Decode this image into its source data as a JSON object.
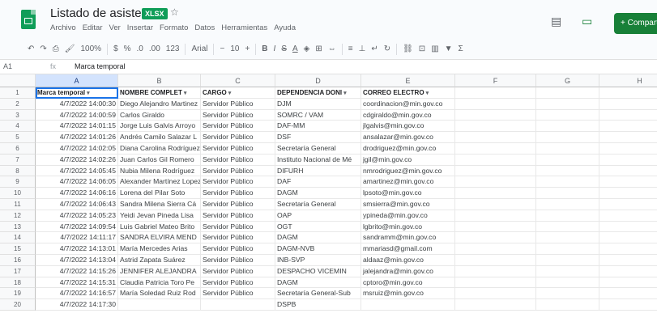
{
  "header": {
    "title": "Listado de asistencia",
    "badge": "XLSX",
    "menu": [
      "Archivo",
      "Editar",
      "Ver",
      "Insertar",
      "Formato",
      "Datos",
      "Herramientas",
      "Ayuda"
    ],
    "share_label": "+ Compartir"
  },
  "toolbar": {
    "zoom": "100%",
    "font": "Arial",
    "font_size": "10"
  },
  "formula_bar": {
    "cell_ref": "A1",
    "fx": "fx",
    "value": "Marca temporal"
  },
  "columns": [
    "A",
    "B",
    "C",
    "D",
    "E",
    "F",
    "G",
    "H"
  ],
  "table": {
    "headers": [
      "Marca temporal",
      "NOMBRE COMPLET",
      "CARGO",
      "DEPENDENCIA DONI",
      "CORREO ELECTRO"
    ],
    "rows": [
      [
        "4/7/2022 14:00:30",
        "Diego Alejandro Martinez",
        "Servidor Público",
        "DJM",
        "coordinacion@min.gov.co"
      ],
      [
        "4/7/2022 14:00:59",
        "Carlos Giraldo",
        "Servidor Público",
        "SOMRC / VAM",
        "cdgiraldo@min.gov.co"
      ],
      [
        "4/7/2022 14:01:15",
        "Jorge Luis Galvis Arroyo",
        "Servidor Público",
        "DAF-MM",
        "jlgalvis@min.gov.co"
      ],
      [
        "4/7/2022 14:01:26",
        "Andrés Camilo Salazar L",
        "Servidor Público",
        "DSF",
        "ansalazar@min.gov.co"
      ],
      [
        "4/7/2022 14:02:05",
        "Diana Carolina Rodríguez",
        "Servidor Público",
        "Secretaría General",
        "drodriguez@min.gov.co"
      ],
      [
        "4/7/2022 14:02:26",
        "Juan Carlos Gil Romero",
        "Servidor Público",
        "Instituto Nacional de Mé",
        "jgil@min.gov.co"
      ],
      [
        "4/7/2022 14:05:45",
        "Nubia Milena Rodríguez",
        "Servidor Público",
        "DIFURH",
        "nmrodriguez@min.gov.co"
      ],
      [
        "4/7/2022 14:06:05",
        "Alexander Martínez Lopez",
        "Servidor Público",
        "DAF",
        "amartinez@min.gov.co"
      ],
      [
        "4/7/2022 14:06:16",
        "Lorena del Pilar Soto",
        "Servidor Público",
        "DAGM",
        "lpsoto@min.gov.co"
      ],
      [
        "4/7/2022 14:06:43",
        "Sandra Milena Sierra Cá",
        "Servidor Público",
        "Secretaría General",
        "smsierra@min.gov.co"
      ],
      [
        "4/7/2022 14:05:23",
        "Yeidi Jevan Pineda Lisa",
        "Servidor Público",
        "OAP",
        "ypineda@min.gov.co"
      ],
      [
        "4/7/2022 14:09:54",
        "Luis Gabriel Mateo Brito",
        "Servidor Público",
        "OGT",
        "lgbrito@min.gov.co"
      ],
      [
        "4/7/2022 14:11:17",
        "SANDRA ELVIRA MEND",
        "Servidor Público",
        "DAGM",
        "sandramm@min.gov.co"
      ],
      [
        "4/7/2022 14:13:01",
        "María Mercedes Arias",
        "Servidor Público",
        "DAGM-NVB",
        "mmariasd@gmail.com"
      ],
      [
        "4/7/2022 14:13:04",
        "Astrid Zapata Suárez",
        "Servidor Público",
        "INB-SVP",
        "aldaaz@min.gov.co"
      ],
      [
        "4/7/2022 14:15:26",
        "JENNIFER ALEJANDRA",
        "Servidor Público",
        "DESPACHO VICEMIN",
        "jalejandra@min.gov.co"
      ],
      [
        "4/7/2022 14:15:31",
        "Claudia Patricia Toro Pe",
        "Servidor Público",
        "DAGM",
        "cptoro@min.gov.co"
      ],
      [
        "4/7/2022 14:16:57",
        "María Soledad Ruiz Rod",
        "Servidor Público",
        "Secretaría General-Sub",
        "msruiz@min.gov.co"
      ],
      [
        "4/7/2022 14:17:30",
        "",
        "",
        "DSPB",
        ""
      ]
    ]
  }
}
